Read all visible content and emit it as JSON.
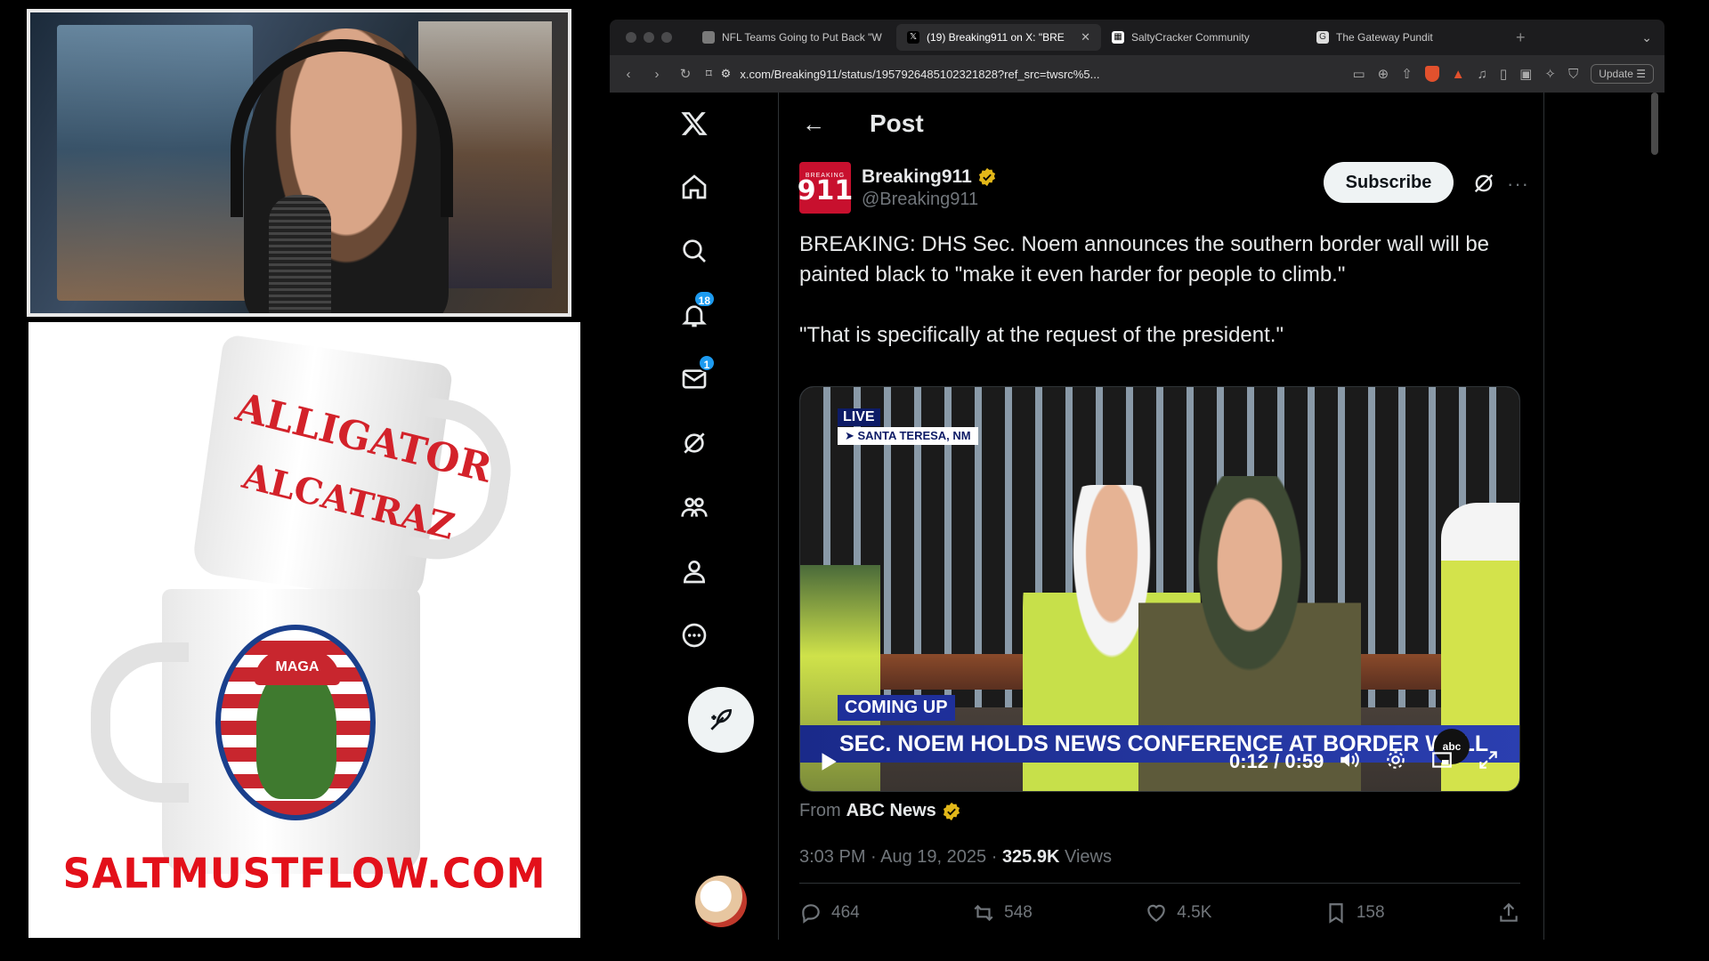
{
  "stream": {
    "mug_line1": "ALLIGATOR",
    "mug_line2": "ALCATRAZ",
    "badge_cap": "MAGA",
    "site": "SALTMUSTFLOW.COM"
  },
  "browser": {
    "tabs": [
      {
        "label": "NFL Teams Going to Put Back \"W",
        "icon": "tab-icon",
        "active": false
      },
      {
        "label": "(19) Breaking911 on X: \"BRE",
        "icon": "x-logo-icon",
        "active": true
      },
      {
        "label": "SaltyCracker Community",
        "icon": "grid-icon",
        "active": false
      },
      {
        "label": "The Gateway Pundit",
        "icon": "gp-icon",
        "active": false
      }
    ],
    "url": "x.com/Breaking911/status/1957926485102321828?ref_src=twsrc%5...",
    "update_label": "Update"
  },
  "nav": {
    "notifications_badge": "18",
    "messages_badge": "1"
  },
  "post": {
    "header_title": "Post",
    "author_logo_small": "BREAKING",
    "author_logo_number": "911",
    "author_name": "Breaking911",
    "author_handle": "@Breaking911",
    "subscribe_label": "Subscribe",
    "text_p1": "BREAKING: DHS Sec. Noem announces the southern border wall will be painted black to \"make it even harder for people to climb.\"",
    "text_p2": "\"That is specifically at the request of the president.\"",
    "video": {
      "live_label": "LIVE",
      "location": "SANTA TERESA, NM",
      "coming_up": "COMING UP",
      "headline": "SEC. NOEM HOLDS NEWS CONFERENCE AT BORDER WALL",
      "network": "abc",
      "time": "0:12 / 0:59"
    },
    "source_prefix": "From",
    "source_name": "ABC News",
    "timestamp": "3:03 PM · Aug 19, 2025 ·",
    "views_count": "325.9K",
    "views_label": "Views",
    "replies": "464",
    "reposts": "548",
    "likes": "4.5K",
    "bookmarks": "158"
  },
  "colors": {
    "accent_blue": "#1d9bf0",
    "verified_gold": "#e2b719",
    "brand_red": "#c8102e"
  }
}
